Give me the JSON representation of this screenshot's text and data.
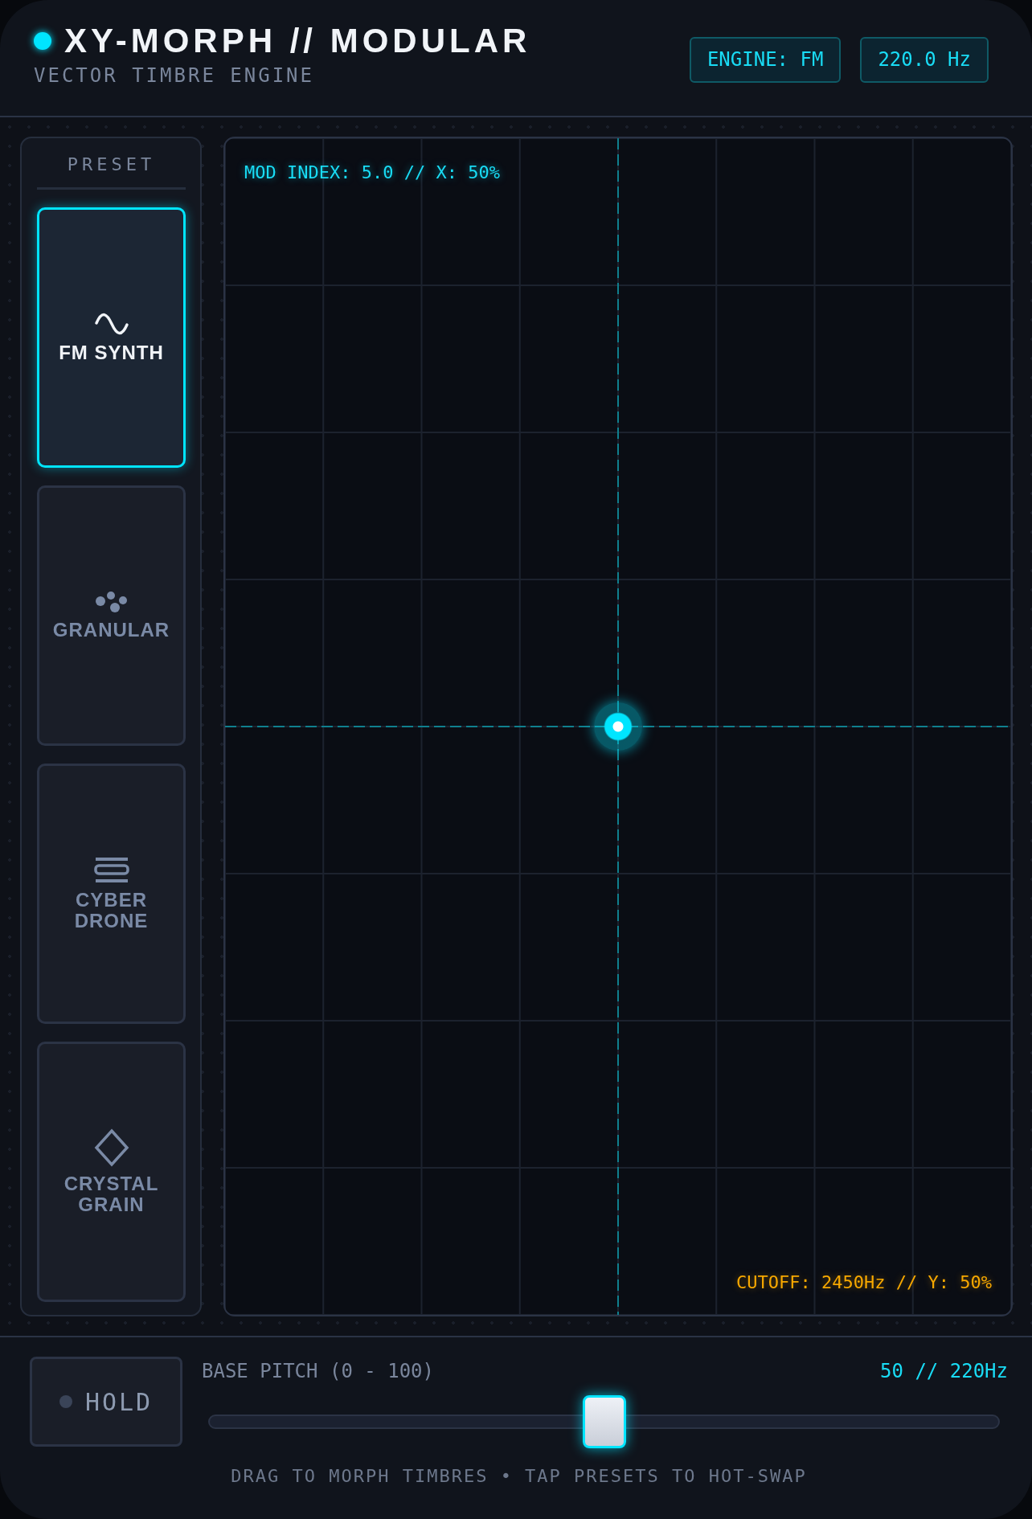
{
  "header": {
    "status_active": true,
    "title": "XY-MORPH // MODULAR",
    "subtitle": "VECTOR TIMBRE ENGINE",
    "badges": [
      "ENGINE: FM",
      "220.0 Hz"
    ]
  },
  "presets": {
    "heading": "PRESET",
    "items": [
      {
        "label": "FM SYNTH",
        "kind": "sine",
        "selected": true
      },
      {
        "label": "GRANULAR",
        "kind": "dots",
        "selected": false
      },
      {
        "label": "CYBER DRONE",
        "kind": "bars",
        "selected": false
      },
      {
        "label": "CRYSTAL GRAIN",
        "kind": "diamond",
        "selected": false
      }
    ]
  },
  "pad": {
    "x_readout": "MOD INDEX: 5.0 // X: 50%",
    "y_readout": "CUTOFF: 2450Hz // Y: 50%",
    "cursor": {
      "x": {
        "level": 0.5
      },
      "y": {
        "level": 0.5
      }
    }
  },
  "controls": {
    "hold": {
      "label": "HOLD",
      "on": false
    },
    "pitch": {
      "label": "BASE PITCH (0 - 100)",
      "reading": "50 // 220Hz",
      "level": 0.5
    },
    "hint": "DRAG TO MORPH TIMBRES • TAP PRESETS TO HOT-SWAP"
  }
}
